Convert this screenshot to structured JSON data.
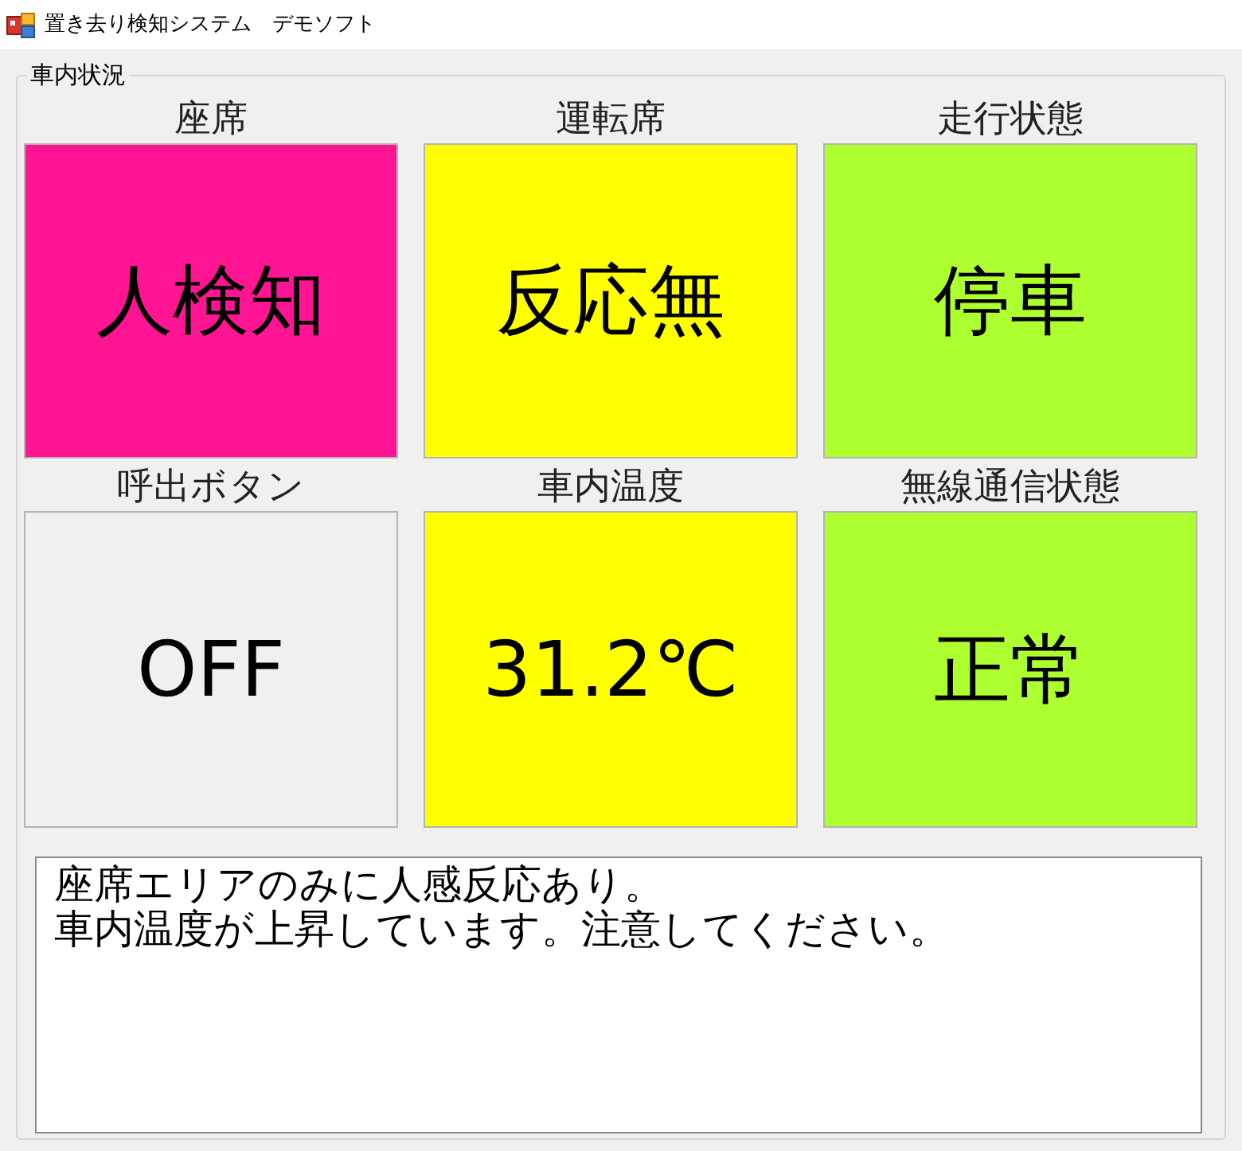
{
  "window": {
    "title": "置き去り検知システム　デモソフト"
  },
  "group": {
    "title": "車内状況"
  },
  "panels": [
    {
      "label": "座席",
      "value": "人検知",
      "color": "#ff1493"
    },
    {
      "label": "運転席",
      "value": "反応無",
      "color": "#ffff00"
    },
    {
      "label": "走行状態",
      "value": "停車",
      "color": "#adff2f"
    },
    {
      "label": "呼出ボタン",
      "value": "OFF",
      "color": "#f0f0f0"
    },
    {
      "label": "車内温度",
      "value": "31.2℃",
      "color": "#ffff00"
    },
    {
      "label": "無線通信状態",
      "value": "正常",
      "color": "#adff2f"
    }
  ],
  "message": {
    "lines": [
      "座席エリアのみに人感反応あり。",
      "車内温度が上昇しています。注意してください。"
    ]
  }
}
